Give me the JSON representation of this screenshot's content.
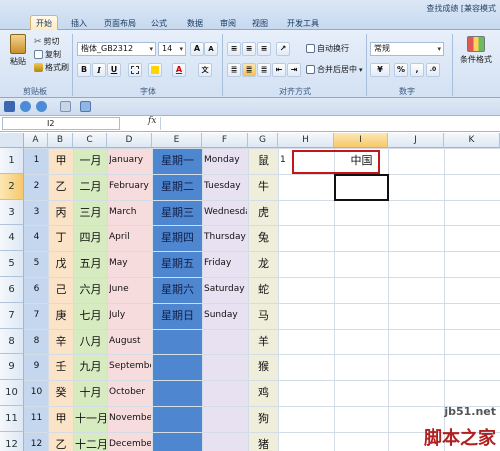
{
  "title_bar": {
    "text": "查找成绩 [兼容模式"
  },
  "tabs": [
    {
      "label": "开始",
      "active": true
    },
    {
      "label": "插入"
    },
    {
      "label": "页面布局"
    },
    {
      "label": "公式"
    },
    {
      "label": "数据"
    },
    {
      "label": "审阅"
    },
    {
      "label": "视图"
    },
    {
      "label": "开发工具"
    }
  ],
  "ribbon": {
    "clipboard": {
      "paste": "粘贴",
      "cut": "剪切",
      "copy": "复制",
      "format_painter": "格式刷",
      "group": "剪贴板"
    },
    "font": {
      "name": "楷体_GB2312",
      "size": "14",
      "group": "字体",
      "bold": "B",
      "italic": "I",
      "underline": "U",
      "grow": "A",
      "shrink": "A",
      "font_color": "A"
    },
    "align": {
      "wrap": "自动换行",
      "merge": "合并后居中",
      "group": "对齐方式"
    },
    "number": {
      "format": "常规",
      "percent": "%",
      "comma": ",",
      "group": "数字"
    },
    "styles": {
      "conditional": "条件格式"
    }
  },
  "formula_bar": {
    "cell_ref": "I2",
    "fx": "fx",
    "content": ""
  },
  "columns": [
    "A",
    "B",
    "C",
    "D",
    "E",
    "F",
    "G",
    "H",
    "I",
    "J",
    "K"
  ],
  "selected_column": "I",
  "rows": [
    "1",
    "2",
    "3",
    "4",
    "5",
    "6",
    "7",
    "8",
    "9",
    "10",
    "11",
    "12"
  ],
  "selected_row": "2",
  "sheet": {
    "A": [
      "1",
      "2",
      "3",
      "4",
      "5",
      "6",
      "7",
      "8",
      "9",
      "10",
      "11",
      "12"
    ],
    "B": [
      "甲",
      "乙",
      "丙",
      "丁",
      "戊",
      "己",
      "庚",
      "辛",
      "壬",
      "癸",
      "甲",
      "乙"
    ],
    "C": [
      "一月",
      "二月",
      "三月",
      "四月",
      "五月",
      "六月",
      "七月",
      "八月",
      "九月",
      "十月",
      "十一月",
      "十二月"
    ],
    "D": [
      "January",
      "February",
      "March",
      "April",
      "May",
      "June",
      "July",
      "August",
      "September",
      "October",
      "November",
      "December"
    ],
    "E": [
      "星期一",
      "星期二",
      "星期三",
      "星期四",
      "星期五",
      "星期六",
      "星期日",
      "",
      "",
      "",
      "",
      ""
    ],
    "F": [
      "Monday",
      "Tuesday",
      "Wednesday",
      "Thursday",
      "Friday",
      "Saturday",
      "Sunday",
      "",
      "",
      "",
      "",
      ""
    ],
    "G": [
      "鼠",
      "牛",
      "虎",
      "兔",
      "龙",
      "蛇",
      "马",
      "羊",
      "猴",
      "鸡",
      "狗",
      "猪"
    ],
    "H1": "1",
    "I1": "中国"
  },
  "colors": {
    "col_A": "#c5d7ee",
    "col_B": "#fbe3c8",
    "col_C": "#d6ecc0",
    "col_D": "#f6dcdc",
    "col_E": "#4f86d0",
    "col_F": "#e8e1f2",
    "col_G": "#eeeeda",
    "highlight": "#c0161c"
  },
  "watermark": {
    "site": "jb51.net",
    "brand": "脚本之家"
  }
}
